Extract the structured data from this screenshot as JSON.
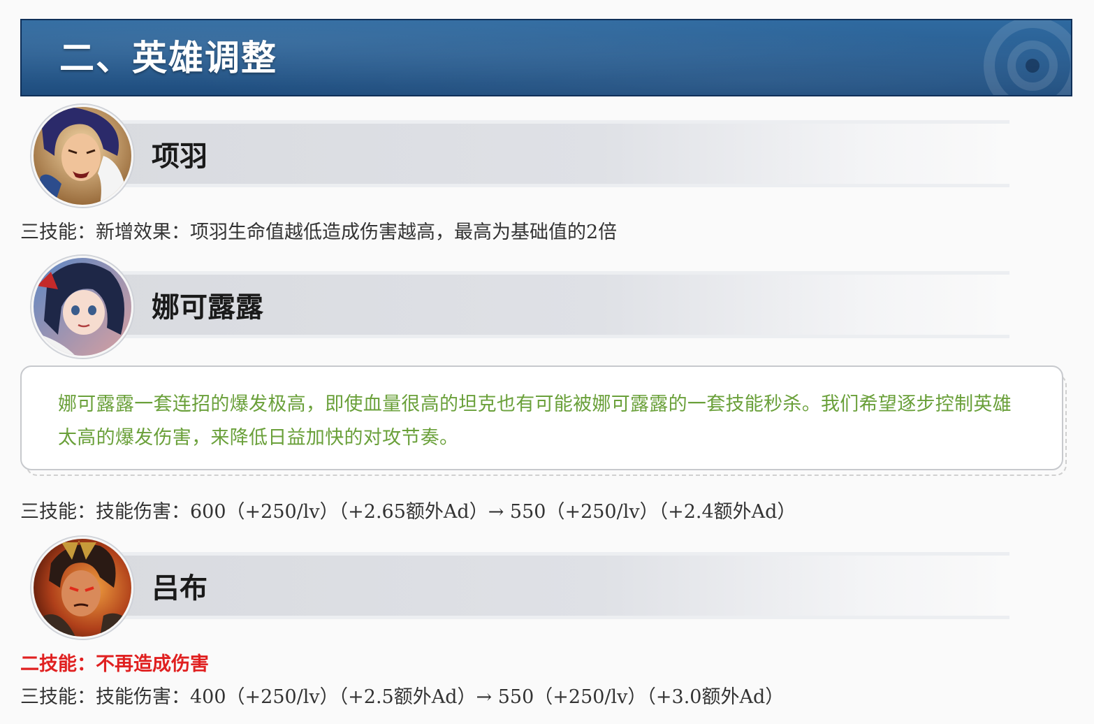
{
  "section": {
    "title": "二、英雄调整"
  },
  "heroes": [
    {
      "name": "项羽",
      "avatar_icon": "xiang-yu-portrait-icon",
      "changes": [
        {
          "text": "三技能：新增效果：项羽生命值越低造成伤害越高，最高为基础值的2倍",
          "highlight": false
        }
      ]
    },
    {
      "name": "娜可露露",
      "avatar_icon": "nakoruru-portrait-icon",
      "note": "娜可露露一套连招的爆发极高，即使血量很高的坦克也有可能被娜可露露的一套技能秒杀。我们希望逐步控制英雄太高的爆发伤害，来降低日益加快的对攻节奏。",
      "changes": [
        {
          "text": "三技能：技能伤害：600（+250/lv）（+2.65额外Ad）→ 550（+250/lv）（+2.4额外Ad）",
          "highlight": false
        }
      ]
    },
    {
      "name": "吕布",
      "avatar_icon": "lu-bu-portrait-icon",
      "changes": [
        {
          "text": "二技能：不再造成伤害",
          "highlight": true
        },
        {
          "text": "三技能：技能伤害：400（+250/lv）（+2.5额外Ad）→ 550（+250/lv）（+3.0额外Ad）",
          "highlight": false
        }
      ]
    }
  ],
  "colors": {
    "banner": "#2a5f93",
    "note_text": "#6aa03a",
    "highlight": "#e02020",
    "hero_bar": "#dcdee3"
  }
}
